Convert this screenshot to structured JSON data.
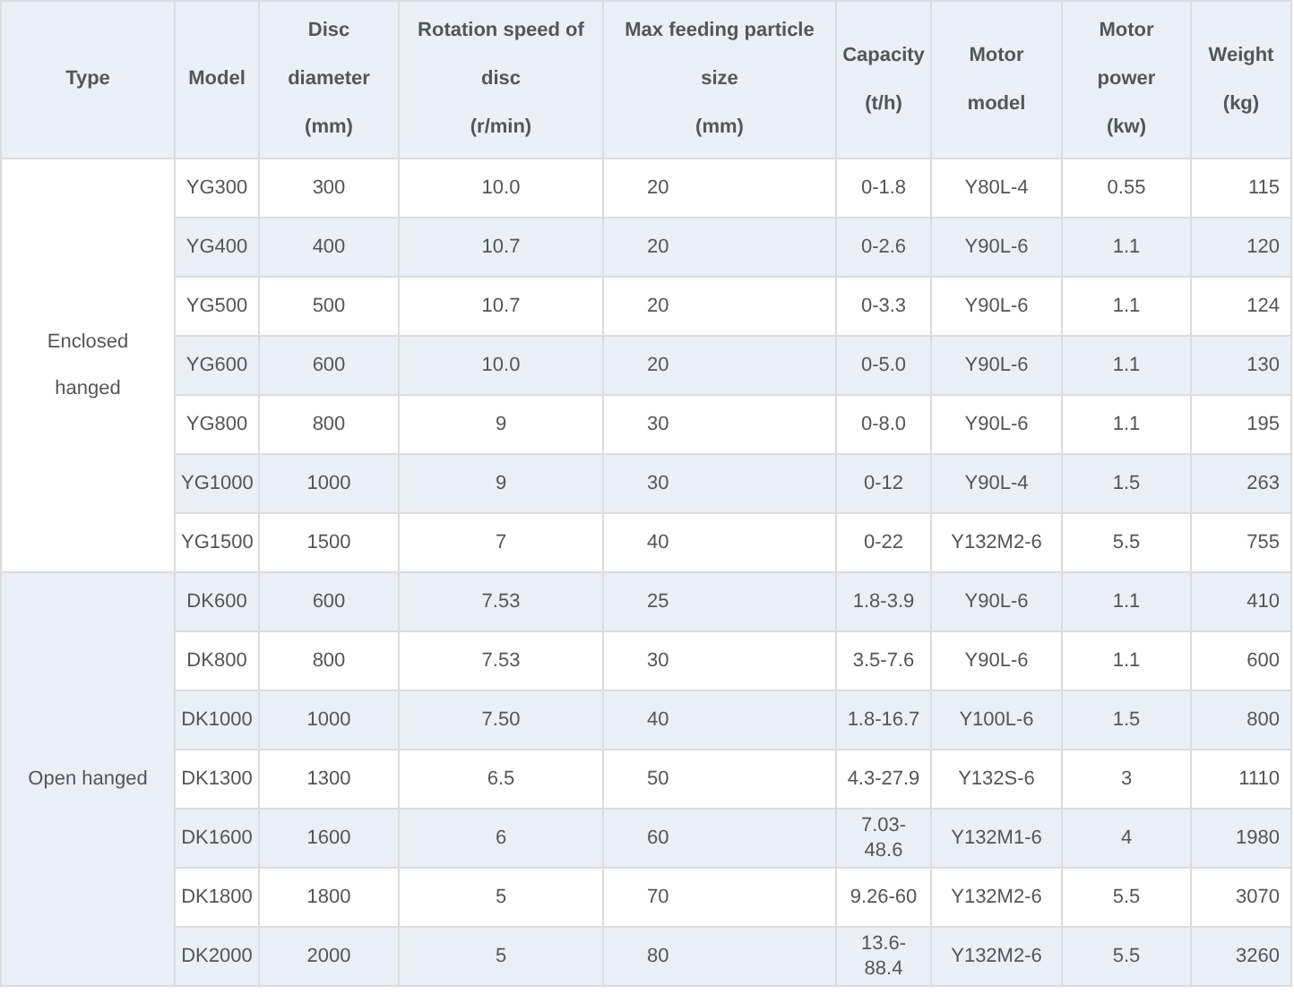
{
  "table": {
    "columns": [
      {
        "lines": [
          "Type"
        ]
      },
      {
        "lines": [
          "Model"
        ]
      },
      {
        "lines": [
          "Disc",
          "diameter",
          "(mm)"
        ]
      },
      {
        "lines": [
          "Rotation speed of",
          "disc",
          "(r/min)"
        ]
      },
      {
        "lines": [
          "Max feeding particle",
          "size",
          "(mm)"
        ]
      },
      {
        "lines": [
          "Capacity",
          "(t/h)"
        ]
      },
      {
        "lines": [
          "Motor",
          "model"
        ]
      },
      {
        "lines": [
          "Motor",
          "power",
          "(kw)"
        ]
      },
      {
        "lines": [
          "Weight",
          "(kg)"
        ]
      }
    ],
    "groups": [
      {
        "type": "Enclosed hanged",
        "rows": [
          [
            "YG300",
            "300",
            "10.0",
            "20",
            "0-1.8",
            "Y80L-4",
            "0.55",
            "115"
          ],
          [
            "YG400",
            "400",
            "10.7",
            "20",
            "0-2.6",
            "Y90L-6",
            "1.1",
            "120"
          ],
          [
            "YG500",
            "500",
            "10.7",
            "20",
            "0-3.3",
            "Y90L-6",
            "1.1",
            "124"
          ],
          [
            "YG600",
            "600",
            "10.0",
            "20",
            "0-5.0",
            "Y90L-6",
            "1.1",
            "130"
          ],
          [
            "YG800",
            "800",
            "9",
            "30",
            "0-8.0",
            "Y90L-6",
            "1.1",
            "195"
          ],
          [
            "YG1000",
            "1000",
            "9",
            "30",
            "0-12",
            "Y90L-4",
            "1.5",
            "263"
          ],
          [
            "YG1500",
            "1500",
            "7",
            "40",
            "0-22",
            "Y132M2-6",
            "5.5",
            "755"
          ]
        ]
      },
      {
        "type": "Open hanged",
        "rows": [
          [
            "DK600",
            "600",
            "7.53",
            "25",
            "1.8-3.9",
            "Y90L-6",
            "1.1",
            "410"
          ],
          [
            "DK800",
            "800",
            "7.53",
            "30",
            "3.5-7.6",
            "Y90L-6",
            "1.1",
            "600"
          ],
          [
            "DK1000",
            "1000",
            "7.50",
            "40",
            "1.8-16.7",
            "Y100L-6",
            "1.5",
            "800"
          ],
          [
            "DK1300",
            "1300",
            "6.5",
            "50",
            "4.3-27.9",
            "Y132S-6",
            "3",
            "1110"
          ],
          [
            "DK1600",
            "1600",
            "6",
            "60",
            "7.03-48.6",
            "Y132M1-6",
            "4",
            "1980"
          ],
          [
            "DK1800",
            "1800",
            "5",
            "70",
            "9.26-60",
            "Y132M2-6",
            "5.5",
            "3070"
          ],
          [
            "DK2000",
            "2000",
            "5",
            "80",
            "13.6-88.4",
            "Y132M2-6",
            "5.5",
            "3260"
          ]
        ]
      }
    ]
  }
}
